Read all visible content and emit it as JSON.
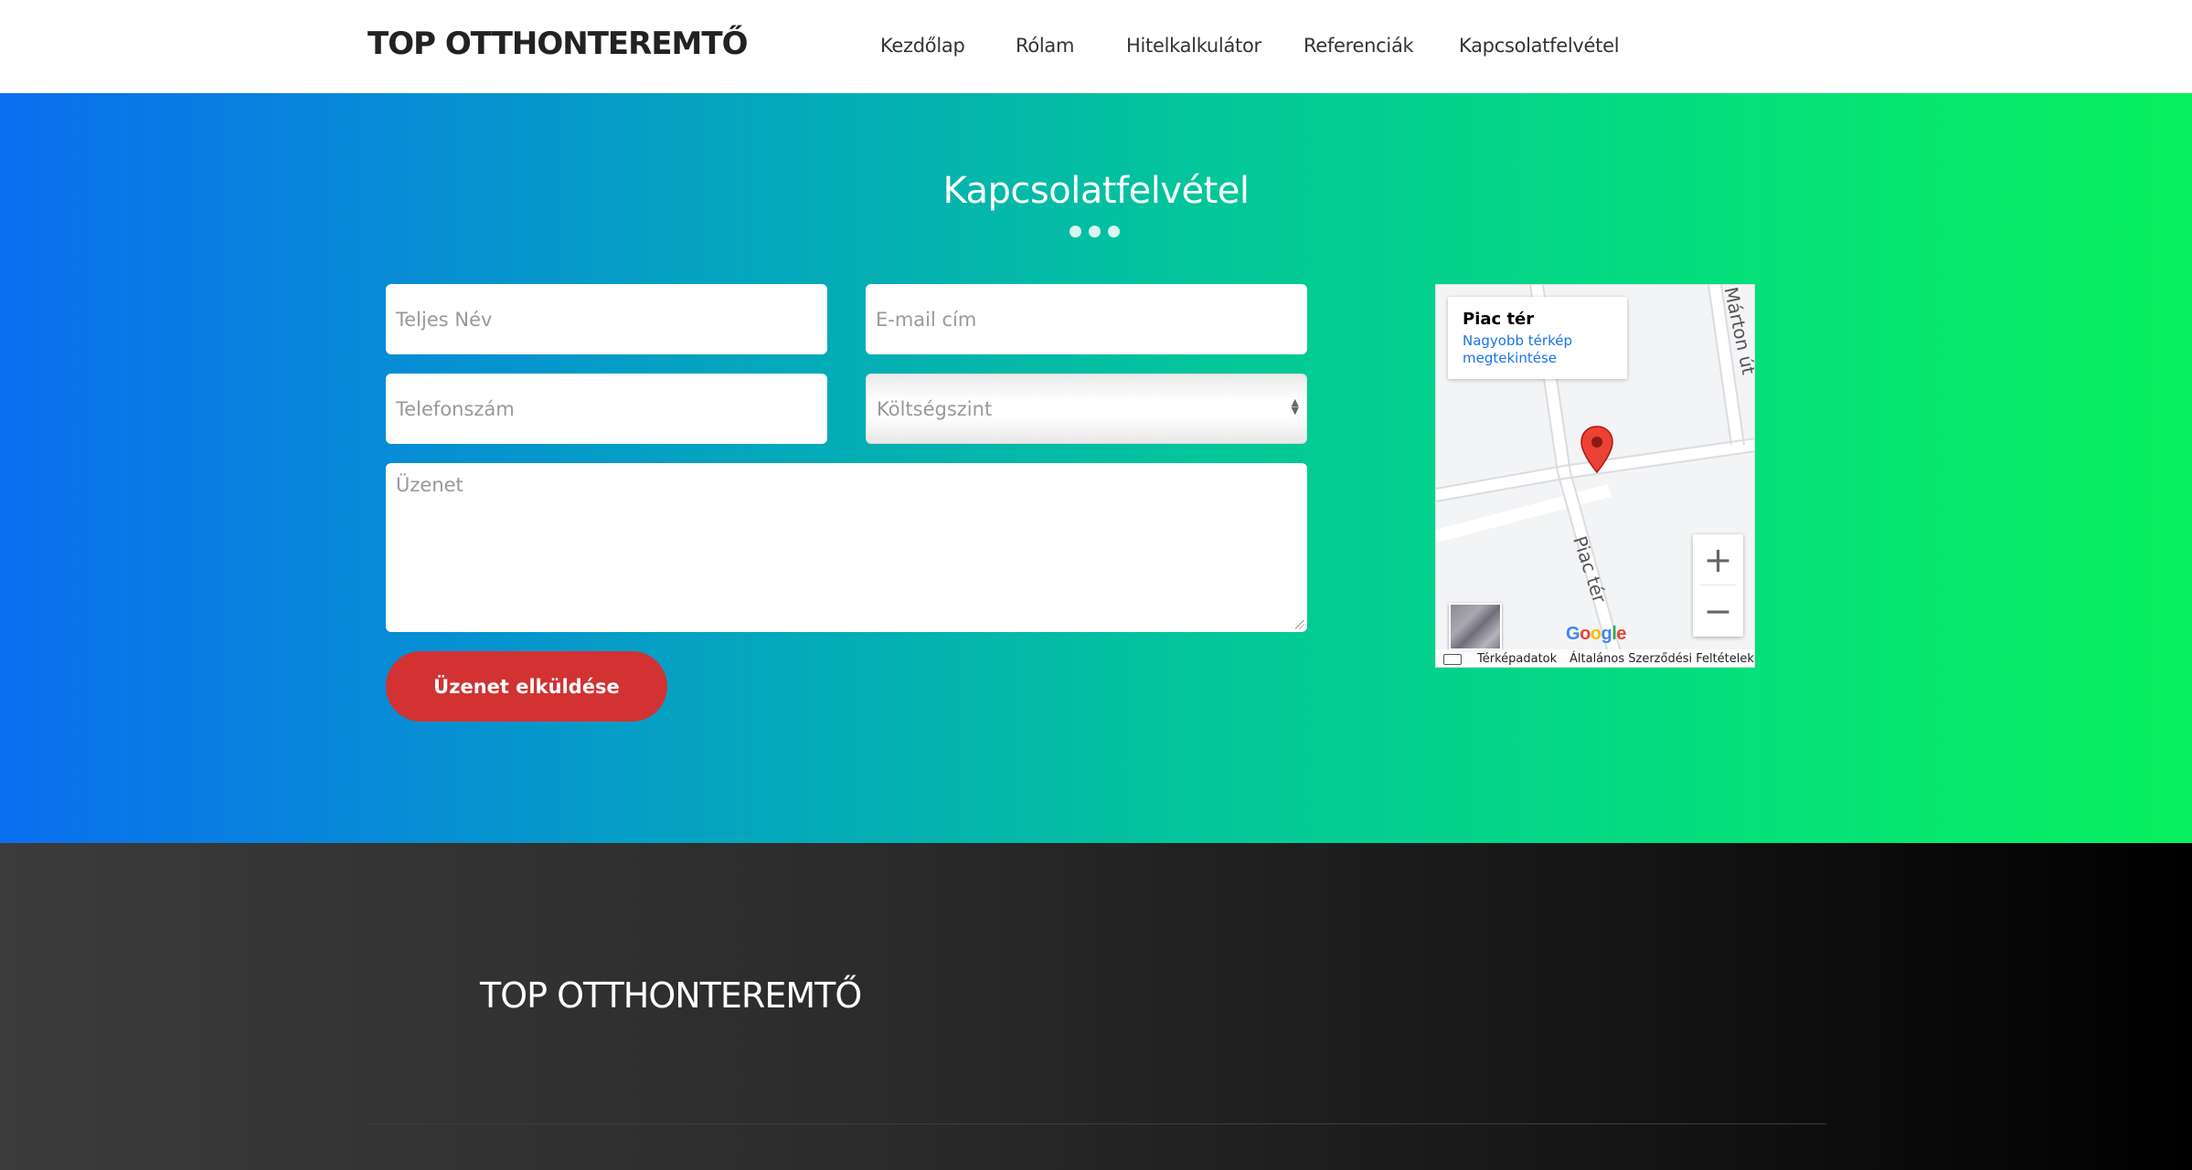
{
  "header": {
    "logo": "TOP OTTHONTEREMTŐ",
    "nav": [
      {
        "label": "Kezdőlap"
      },
      {
        "label": "Rólam"
      },
      {
        "label": "Hitelkalkulátor"
      },
      {
        "label": "Referenciák"
      },
      {
        "label": "Kapcsolatfelvétel"
      }
    ]
  },
  "contact": {
    "title": "Kapcsolatfelvétel",
    "fields": {
      "name_placeholder": "Teljes Név",
      "email_placeholder": "E-mail cím",
      "phone_placeholder": "Telefonszám",
      "budget_selected": "Költségszint",
      "message_placeholder": "Üzenet"
    },
    "submit_label": "Üzenet elküldése"
  },
  "map": {
    "place_name": "Piac tér",
    "larger_map_link": "Nagyobb térkép megtekintése",
    "street_1": "Piac tér",
    "street_2": "Márton út",
    "zoom_in": "+",
    "zoom_out": "−",
    "google_logo": "Google",
    "map_data_label": "Térképadatok",
    "terms_label": "Általános Szerződési Feltételek",
    "marker_color": "#ea4335"
  },
  "footer": {
    "logo": "TOP OTTHONTEREMTŐ"
  },
  "colors": {
    "accent_button": "#d23232",
    "gradient_start": "#0a6ef0",
    "gradient_end": "#08f05e"
  }
}
